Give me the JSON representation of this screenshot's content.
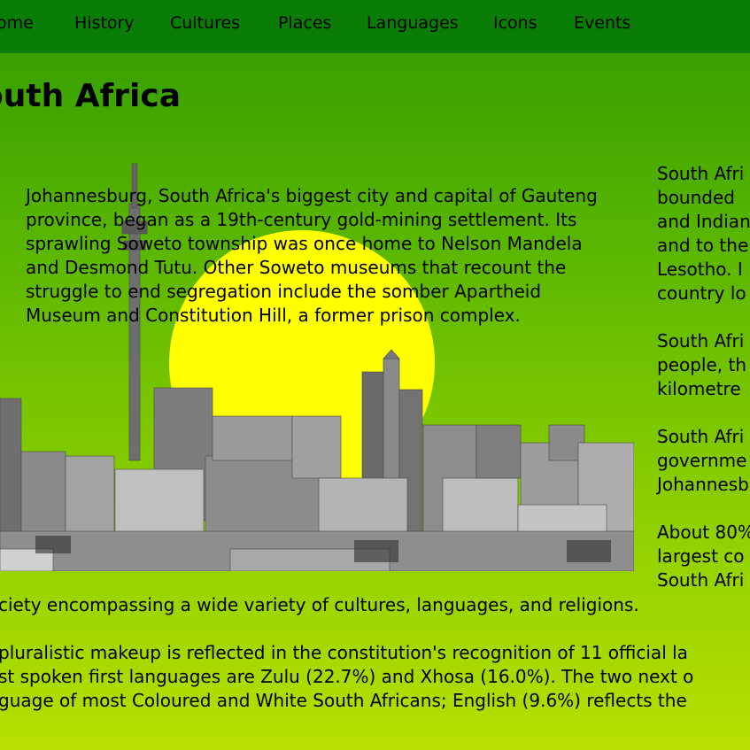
{
  "nav": {
    "items": [
      "ome",
      "History",
      "Cultures",
      "Places",
      "Languages",
      "Icons",
      "Events"
    ]
  },
  "page": {
    "title": "outh Africa"
  },
  "intro": {
    "text": "Johannesburg, South Africa's biggest city and capital of Gauteng province, began as a 19th-century gold-mining settlement. Its sprawling Soweto township was once home to Nelson Mandela and Desmond Tutu. Other Soweto museums that recount the struggle to end segregation include the somber Apartheid Museum and Constitution Hill, a former prison complex."
  },
  "right_column": {
    "p1": "South Afri\nbounded\nand Indian\nand to the\nLesotho. I\ncountry lo",
    "p2": "South Afri\npeople, th\nkilometre",
    "p3": "South Afri\ngovernme\nJohannesb",
    "p4": "About 80%\nlargest co\nSouth Afri"
  },
  "bottom": {
    "line1": "ciety encompassing a wide variety of cultures, languages, and religions.",
    "line2": "pluralistic makeup is reflected in the constitution's recognition of 11 official la",
    "line3": "st spoken first languages are Zulu (22.7%) and Xhosa (16.0%). The two next o",
    "line4": "guage of most Coloured and White South Africans; English (9.6%) reflects the"
  },
  "colors": {
    "nav_bg": "#0a7d06",
    "sun": "#ffff00",
    "background_top": "#2f9a00",
    "background_bottom": "#b6e000"
  }
}
